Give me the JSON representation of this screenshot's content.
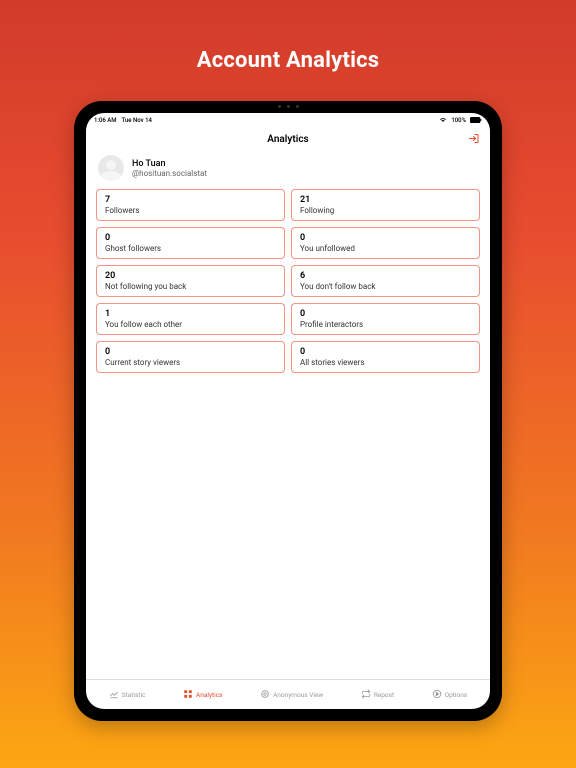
{
  "hero": {
    "title": "Account Analytics"
  },
  "status": {
    "time": "1:06 AM",
    "date": "Tue Nov 14",
    "battery": "100%"
  },
  "nav": {
    "title": "Analytics"
  },
  "profile": {
    "name": "Ho Tuan",
    "handle": "@hosituan.socialstat"
  },
  "cards": [
    {
      "value": "7",
      "label": "Followers"
    },
    {
      "value": "21",
      "label": "Following"
    },
    {
      "value": "0",
      "label": "Ghost followers"
    },
    {
      "value": "0",
      "label": "You unfollowed"
    },
    {
      "value": "20",
      "label": "Not following you back"
    },
    {
      "value": "6",
      "label": "You don't follow back"
    },
    {
      "value": "1",
      "label": "You follow each other"
    },
    {
      "value": "0",
      "label": "Profile interactors"
    },
    {
      "value": "0",
      "label": "Current story viewers"
    },
    {
      "value": "0",
      "label": "All stories viewers"
    }
  ],
  "tabs": [
    {
      "label": "Statistic"
    },
    {
      "label": "Analytics"
    },
    {
      "label": "Anonymous View"
    },
    {
      "label": "Repost"
    },
    {
      "label": "Options"
    }
  ]
}
